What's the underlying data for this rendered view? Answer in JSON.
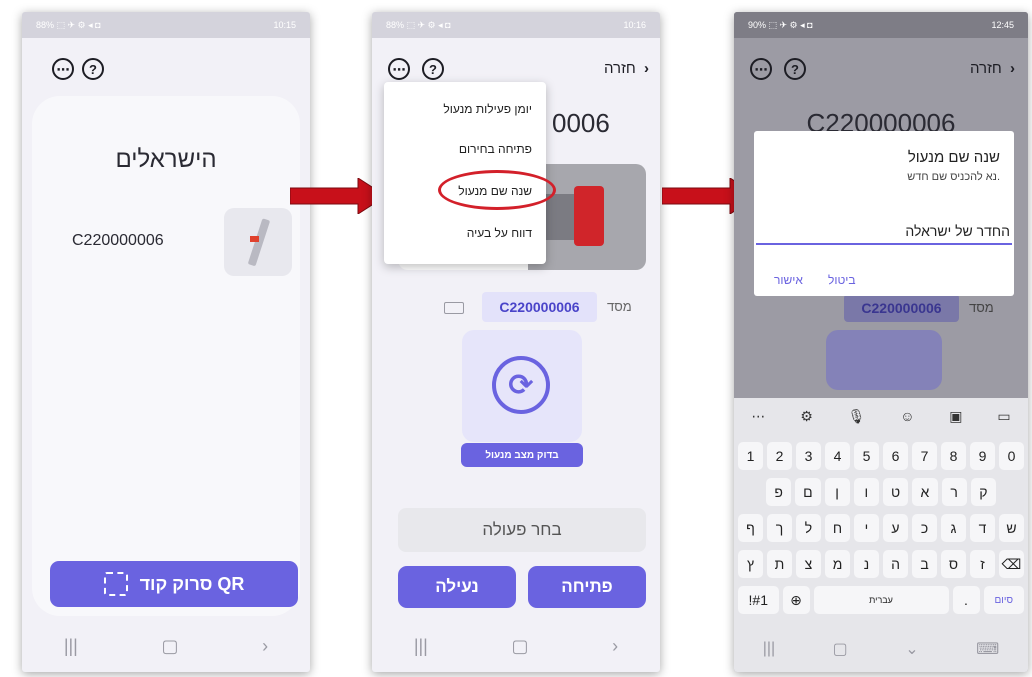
{
  "screen1": {
    "status_left": "88% ⬚ ✈ ⚙ ◂ ◘",
    "status_time": "10:15",
    "group_title": "הישראלים",
    "lock_id": "C220000006",
    "scan_button": "סרוק קוד QR"
  },
  "screen2": {
    "status_left": "88% ⬚ ✈ ⚙ ◂ ◘",
    "status_time": "10:16",
    "back_label": "חזרה",
    "lock_id_partial": "0006",
    "menu_items": [
      "יומן פעילות מנעול",
      "פתיחה בחירום",
      "שנה שם מנעול",
      "דווח על בעיה"
    ],
    "serial_label": "מסד",
    "serial_value": "C220000006",
    "check_status_button": "בדוק מצב מנעול",
    "choose_action": "בחר פעולה",
    "lock_button": "נעילה",
    "open_button": "פתיחה"
  },
  "screen3": {
    "status_left": "90% ⬚ ✈ ⚙ ◂ ◘",
    "status_time": "12:45",
    "back_label": "חזרה",
    "lock_id": "C220000006",
    "dialog_title": "שנה שם מנעול",
    "dialog_subtitle": "נא להכניס שם חדש.",
    "dialog_input_value": "החדר של ישראלה",
    "dialog_cancel": "ביטול",
    "dialog_ok": "אישור",
    "serial_label": "מסד",
    "serial_value": "C220000006",
    "keyboard": {
      "number_row": [
        "1",
        "2",
        "3",
        "4",
        "5",
        "6",
        "7",
        "8",
        "9",
        "0"
      ],
      "row1": [
        "פ",
        "ם",
        "ן",
        "ו",
        "ט",
        "א",
        "ר",
        "ק"
      ],
      "row2": [
        "ף",
        "ך",
        "ל",
        "ח",
        "י",
        "ע",
        "כ",
        "ג",
        "ד",
        "ש"
      ],
      "row3": [
        "ץ",
        "ת",
        "צ",
        "מ",
        "נ",
        "ה",
        "ב",
        "ס",
        "ז"
      ],
      "symbols_key": "!#1",
      "space_label": "עברית",
      "period_key": ".",
      "done_key": "סיום"
    }
  },
  "colors": {
    "accent": "#6a63e0",
    "highlight_circle": "#d3202a",
    "arrow": "#c8101a"
  }
}
